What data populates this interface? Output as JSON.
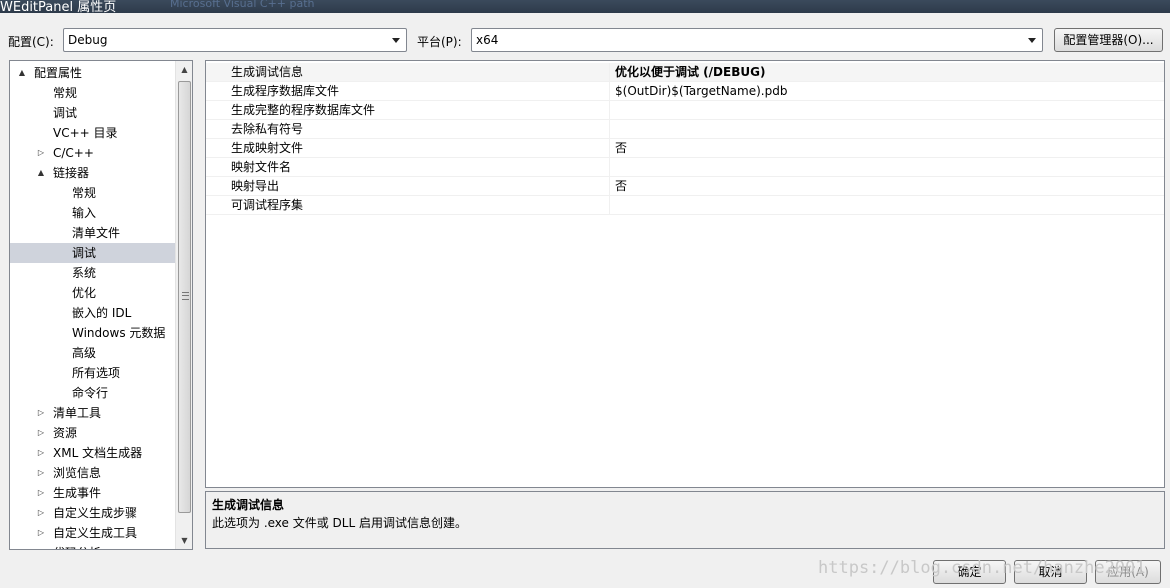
{
  "window": {
    "title": "WEditPanel 属性页",
    "blurred_tab": "Microsoft Visual C++ path"
  },
  "toolbar": {
    "config_label": "配置(C):",
    "config_value": "Debug",
    "platform_label": "平台(P):",
    "platform_value": "x64",
    "config_manager_label": "配置管理器(O)..."
  },
  "tree": {
    "items": [
      {
        "label": "配置属性",
        "expander": "▲",
        "level": 0
      },
      {
        "label": "常规",
        "expander": "",
        "level": 1
      },
      {
        "label": "调试",
        "expander": "",
        "level": 1
      },
      {
        "label": "VC++ 目录",
        "expander": "",
        "level": 1
      },
      {
        "label": "C/C++",
        "expander": "▷",
        "level": 1
      },
      {
        "label": "链接器",
        "expander": "▲",
        "level": 1
      },
      {
        "label": "常规",
        "expander": "",
        "level": 2
      },
      {
        "label": "输入",
        "expander": "",
        "level": 2
      },
      {
        "label": "清单文件",
        "expander": "",
        "level": 2
      },
      {
        "label": "调试",
        "expander": "",
        "level": 2,
        "selected": true
      },
      {
        "label": "系统",
        "expander": "",
        "level": 2
      },
      {
        "label": "优化",
        "expander": "",
        "level": 2
      },
      {
        "label": "嵌入的 IDL",
        "expander": "",
        "level": 2
      },
      {
        "label": "Windows 元数据",
        "expander": "",
        "level": 2
      },
      {
        "label": "高级",
        "expander": "",
        "level": 2
      },
      {
        "label": "所有选项",
        "expander": "",
        "level": 2
      },
      {
        "label": "命令行",
        "expander": "",
        "level": 2
      },
      {
        "label": "清单工具",
        "expander": "▷",
        "level": 1
      },
      {
        "label": "资源",
        "expander": "▷",
        "level": 1
      },
      {
        "label": "XML 文档生成器",
        "expander": "▷",
        "level": 1
      },
      {
        "label": "浏览信息",
        "expander": "▷",
        "level": 1
      },
      {
        "label": "生成事件",
        "expander": "▷",
        "level": 1
      },
      {
        "label": "自定义生成步骤",
        "expander": "▷",
        "level": 1
      },
      {
        "label": "自定义生成工具",
        "expander": "▷",
        "level": 1
      },
      {
        "label": "代码分析",
        "expander": "▷",
        "level": 1
      }
    ],
    "scroll_up": "▲",
    "scroll_down": "▼"
  },
  "properties": [
    {
      "name": "生成调试信息",
      "value": "优化以便于调试 (/DEBUG)",
      "selected": true
    },
    {
      "name": "生成程序数据库文件",
      "value": "$(OutDir)$(TargetName).pdb"
    },
    {
      "name": "生成完整的程序数据库文件",
      "value": ""
    },
    {
      "name": "去除私有符号",
      "value": ""
    },
    {
      "name": "生成映射文件",
      "value": "否"
    },
    {
      "name": "映射文件名",
      "value": ""
    },
    {
      "name": "映射导出",
      "value": "否"
    },
    {
      "name": "可调试程序集",
      "value": ""
    }
  ],
  "description": {
    "title": "生成调试信息",
    "text": "此选项为 .exe 文件或 DLL 启用调试信息创建。"
  },
  "buttons": {
    "ok": "确定",
    "cancel": "取消",
    "apply": "应用(A)"
  },
  "watermark": "https://blog.csdn.net/hanzhe2001"
}
